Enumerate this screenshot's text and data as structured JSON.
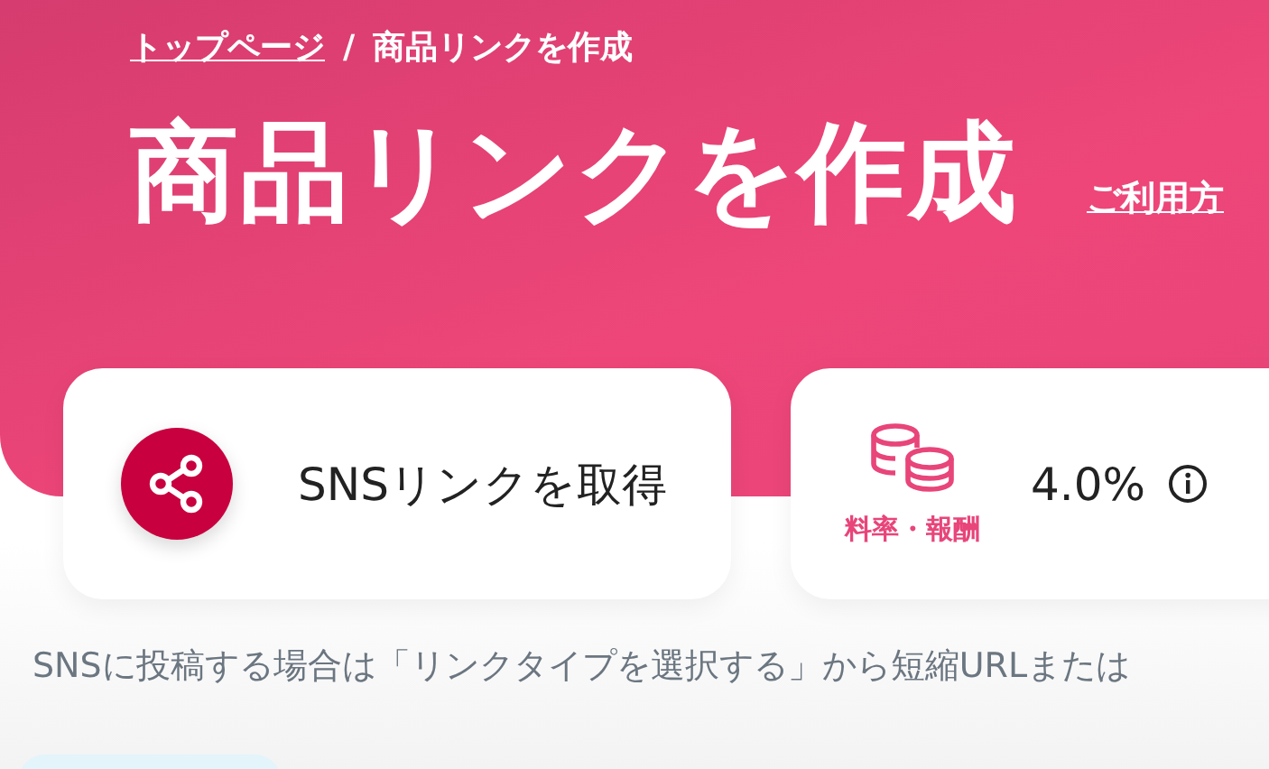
{
  "breadcrumb": [
    {
      "label": "トップページ",
      "kind": "link"
    },
    {
      "label": "商品リンクを作成",
      "kind": "current"
    }
  ],
  "breadcrumb_separator": "/",
  "title": "商品リンクを作成",
  "help_link": "ご利用方",
  "sns_card": {
    "label": "SNSリンクを取得"
  },
  "rate_card": {
    "caption": "料率・報酬",
    "value": "4.0%"
  },
  "description": "SNSに投稿する場合は「リンクタイプを選択する」から短縮URLまたは"
}
